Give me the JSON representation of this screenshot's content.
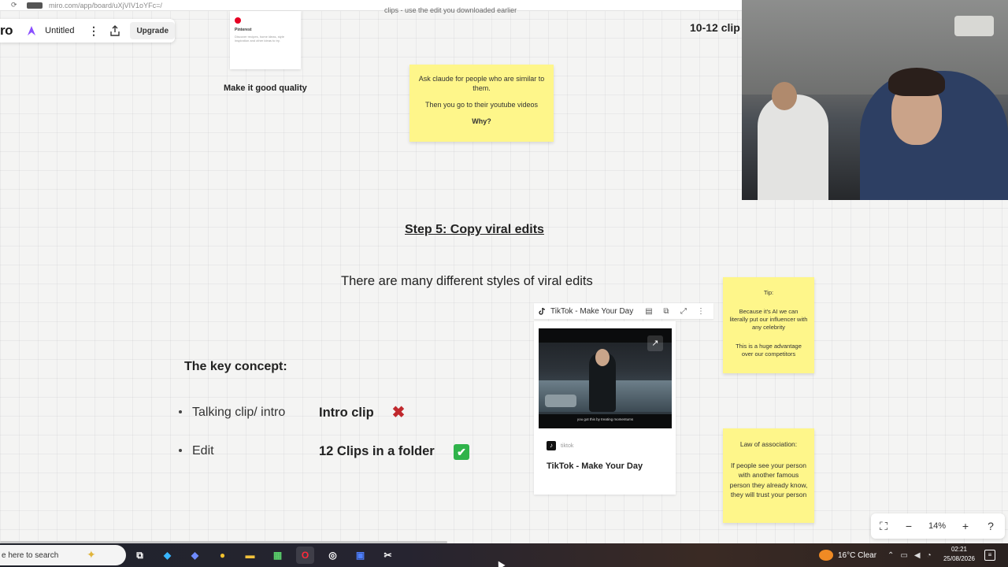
{
  "browser": {
    "url": "miro.com/app/board/uXjVIV1oYFc=/"
  },
  "miro_toolbar": {
    "logo": "ro",
    "board_name": "Untitled",
    "upgrade_label": "Upgrade"
  },
  "top_area": {
    "pinterest_card": {
      "title": "Pinterest",
      "description": "Discover recipes, home ideas, style inspiration and other ideas to try."
    },
    "caption": "Make it good quality",
    "cut_text": "clips - use the edit you downloaded earlier",
    "right_heading": "10-12 clip"
  },
  "sticky_note_1": {
    "line1": "Ask claude for people who are similar to them.",
    "line2": "Then you go to their youtube videos",
    "line3": "Why?"
  },
  "section": {
    "title": "Step 5: Copy viral edits",
    "subtitle": "There are many different styles of viral edits",
    "key_concept": "The key concept:",
    "bullets": [
      {
        "label": "Talking clip/ intro",
        "value": "Intro clip",
        "status_icon": "cross-mark-icon"
      },
      {
        "label": "Edit",
        "value": "12 Clips in a folder",
        "status_icon": "check-mark-icon"
      }
    ]
  },
  "embed": {
    "header_title": "TikTok - Make Your Day",
    "source": "tiktok",
    "card_title": "TikTok - Make Your Day",
    "video_caption": "you got this by treating momentums"
  },
  "sticky_note_2": {
    "line1": "Tip:",
    "line2": "Because it's AI we can literally put our influencer with any celebrity",
    "line3": "This is a huge advantage over our competitors"
  },
  "sticky_note_3": {
    "line1": "Law of association:",
    "line2": "If people see your person with another famous person they already know, they will trust your person"
  },
  "zoom": {
    "level": "14%"
  },
  "taskbar": {
    "search_placeholder": "e here to search",
    "weather": "16°C  Clear",
    "time": "02:21",
    "date": "25/08/2026"
  },
  "colors": {
    "sticky": "#fef68a",
    "accent_check": "#2fb34a",
    "accent_cross": "#c0282d"
  }
}
